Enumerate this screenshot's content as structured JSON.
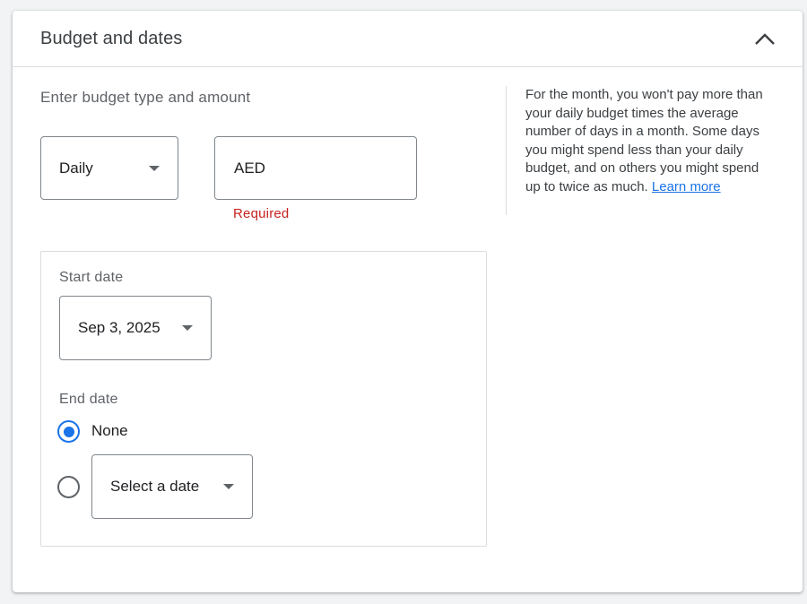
{
  "header": {
    "title": "Budget and dates",
    "collapse_icon": "chevron-up-icon"
  },
  "budget": {
    "section_label": "Enter budget type and amount",
    "type_value": "Daily",
    "currency": "AED",
    "amount_value": "",
    "amount_error": "Required",
    "error_color": "#c5221f"
  },
  "help": {
    "text": "For the month, you won't pay more than your daily budget times the average number of days in a month. Some days you might spend less than your daily budget, and on others you might spend up to twice as much.",
    "link": "Learn more",
    "link_color": "#1a73e8"
  },
  "dates": {
    "start_label": "Start date",
    "start_value": "Sep 3, 2025",
    "end_label": "End date",
    "end_options": {
      "none_label": "None",
      "select_placeholder": "Select a date"
    },
    "selected_end_option": "None",
    "accent_color": "#1a73e8"
  }
}
